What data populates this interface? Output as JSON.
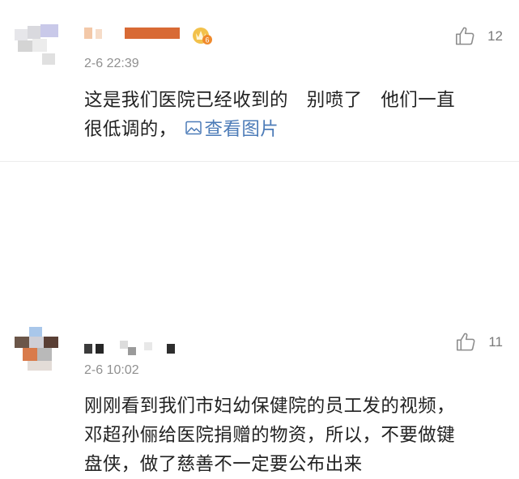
{
  "comments": [
    {
      "time": "2-6 22:39",
      "likes": "12",
      "text_line1": "这是我们医院已经收到的　别喷了　他们一直",
      "text_line2": "很低调的，",
      "link_label": "查看图片",
      "link_icon": "image-icon",
      "badge_icon": "vip-crown-icon"
    },
    {
      "time": "2-6 10:02",
      "likes": "11",
      "text_line1": "刚刚看到我们市妇幼保健院的员工发的视频，",
      "text_line2": "邓超孙俪给医院捐赠的物资，所以，不要做键",
      "text_line3": "盘侠，做了慈善不一定要公布出来"
    }
  ],
  "colors": {
    "link": "#4d7cb8",
    "time": "#909090",
    "text": "#222222",
    "like": "#7a7a7a"
  }
}
